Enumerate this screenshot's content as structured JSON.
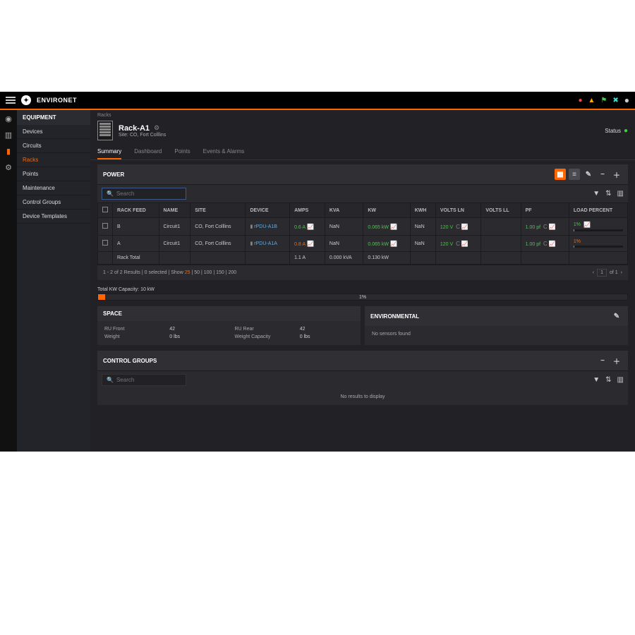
{
  "brand": "ENVIRONET",
  "header_alerts": {
    "red": "●",
    "yellow": "▲",
    "green": "⚑",
    "tools": "✖",
    "user": "👤"
  },
  "sidebar": {
    "title": "EQUIPMENT",
    "items": [
      {
        "label": "Devices"
      },
      {
        "label": "Circuits"
      },
      {
        "label": "Racks"
      },
      {
        "label": "Points"
      },
      {
        "label": "Maintenance"
      },
      {
        "label": "Control Groups"
      },
      {
        "label": "Device Templates"
      }
    ]
  },
  "breadcrumb": "Racks",
  "page": {
    "title": "Rack-A1",
    "site": "Site: CO, Fort Colllins",
    "status_label": "Status"
  },
  "tabs": [
    {
      "label": "Summary"
    },
    {
      "label": "Dashboard"
    },
    {
      "label": "Points"
    },
    {
      "label": "Events & Alarms"
    }
  ],
  "power": {
    "title": "POWER",
    "search_placeholder": "Search",
    "columns": [
      "",
      "RACK FEED",
      "NAME",
      "SITE",
      "DEVICE",
      "AMPS",
      "KVA",
      "KW",
      "KWH",
      "VOLTS LN",
      "VOLTS LL",
      "PF",
      "LOAD PERCENT"
    ],
    "rows": [
      {
        "feed": "B",
        "name": "Circuit1",
        "site": "CO, Fort Colllins",
        "device": "rPDU-A1B",
        "amps": "0.6 A",
        "kva": "NaN",
        "kw": "0.065 kW",
        "kwh": "NaN",
        "vln": "120 V",
        "vll": "",
        "pf": "1.00 pf",
        "load": "1%",
        "load_color": "green"
      },
      {
        "feed": "A",
        "name": "Circuit1",
        "site": "CO, Fort Colllins",
        "device": "rPDU-A1A",
        "amps": "0.8 A",
        "kva": "NaN",
        "kw": "0.065 kW",
        "kwh": "NaN",
        "vln": "120 V",
        "vll": "",
        "pf": "1.00 pf",
        "load": "1%",
        "load_color": "orange"
      }
    ],
    "total": {
      "label": "Rack Total",
      "amps": "1.1 A",
      "kva": "0.000 kVA",
      "kw": "0.130 kW"
    },
    "pager_left_a": "1 - 2 of 2 Results | 0 selected | Show ",
    "pager_25": "25",
    "pager_left_b": " | 50 | 100 | 150 | 200",
    "pager_page": "1",
    "pager_of": "of 1"
  },
  "capacity": {
    "label": "Total KW Capacity: 10 kW",
    "percent": "1%"
  },
  "space": {
    "title": "SPACE",
    "ru_front_l": "RU Front",
    "ru_front_v": "42",
    "ru_rear_l": "RU Rear",
    "ru_rear_v": "42",
    "weight_l": "Weight",
    "weight_v": "0 lbs",
    "wcap_l": "Weight Capacity",
    "wcap_v": "0 lbs"
  },
  "env": {
    "title": "ENVIRONMENTAL",
    "body": "No sensors found"
  },
  "cg": {
    "title": "CONTROL GROUPS",
    "placeholder": "Search",
    "empty": "No results to display"
  }
}
